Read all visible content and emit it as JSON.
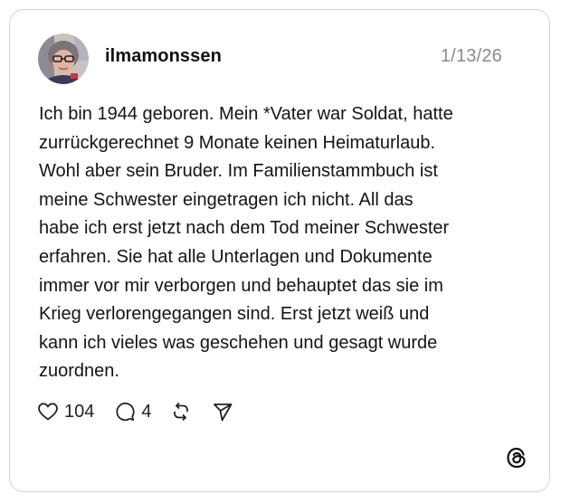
{
  "post": {
    "username": "ilmamonssen",
    "date": "1/13/26",
    "text": "Ich bin 1944 geboren. Mein *Vater war Soldat, hatte\nzurrückgerechnet 9 Monate keinen Heimaturlaub.\nWohl aber sein Bruder. Im Familienstammbuch ist\nmeine Schwester eingetragen ich nicht. All das\nhabe ich erst jetzt nach dem Tod meiner Schwester\nerfahren. Sie hat alle Unterlagen und Dokumente\nimmer vor mir verborgen und behauptet das sie im\nKrieg verlorengegangen sind. Erst jetzt weiß und\nkann ich vieles was geschehen und gesagt wurde\nzuordnen."
  },
  "actions": {
    "like_icon": "heart-icon",
    "like_count": "104",
    "reply_icon": "comment-icon",
    "reply_count": "4",
    "repost_icon": "repost-icon",
    "share_icon": "send-icon"
  },
  "branding": {
    "logo_icon": "threads-logo-icon"
  },
  "colors": {
    "text": "#141414",
    "muted": "#8a8a8a",
    "border": "#d4d4d4"
  }
}
